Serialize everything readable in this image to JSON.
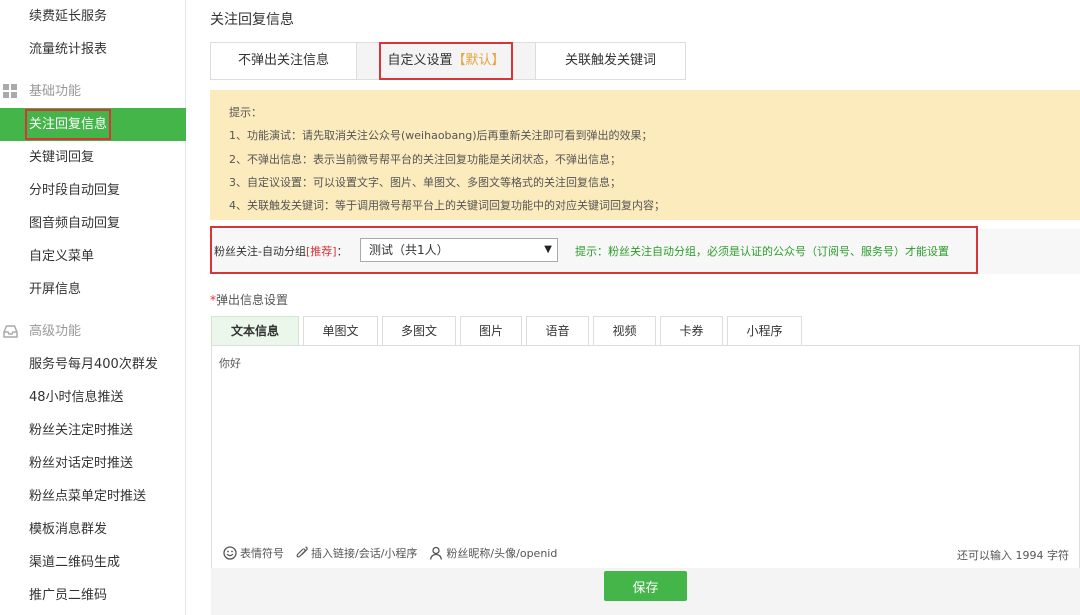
{
  "sidebar": {
    "items_top": [
      {
        "label": "续费延长服务"
      },
      {
        "label": "流量统计报表"
      }
    ],
    "section_basic": {
      "label": "基础功能",
      "icon": "grid-icon"
    },
    "basic_items": [
      {
        "label": "关注回复信息",
        "active": true
      },
      {
        "label": "关键词回复"
      },
      {
        "label": "分时段自动回复"
      },
      {
        "label": "图音频自动回复"
      },
      {
        "label": "自定义菜单"
      },
      {
        "label": "开屏信息"
      }
    ],
    "section_advanced": {
      "label": "高级功能",
      "icon": "inbox-icon"
    },
    "advanced_items": [
      {
        "label": "服务号每月400次群发"
      },
      {
        "label": "48小时信息推送"
      },
      {
        "label": "粉丝关注定时推送"
      },
      {
        "label": "粉丝对话定时推送"
      },
      {
        "label": "粉丝点菜单定时推送"
      },
      {
        "label": "模板消息群发"
      },
      {
        "label": "渠道二维码生成"
      },
      {
        "label": "推广员二维码"
      }
    ]
  },
  "page": {
    "title": "关注回复信息",
    "mode_tabs": [
      {
        "label": "不弹出关注信息"
      },
      {
        "label": "自定义设置",
        "tag": "【默认】",
        "active": true
      },
      {
        "label": "关联触发关键词"
      }
    ],
    "tips": {
      "heading": "提示：",
      "lines": [
        "1、功能演试：请先取消关注公众号(weihaobang)后再重新关注即可看到弹出的效果；",
        "2、不弹出信息：表示当前微号帮平台的关注回复功能是关闭状态，不弹出信息；",
        "3、自定议设置：可以设置文字、图片、单图文、多图文等格式的关注回复信息；",
        "4、关联触发关键词：等于调用微号帮平台上的关键词回复功能中的对应关键词回复内容；"
      ]
    },
    "group": {
      "label_prefix": "粉丝关注-自动分组",
      "label_recommend": "[推荐]",
      "label_suffix": "：",
      "select_value": "测试（共1人）",
      "hint": "提示：粉丝关注自动分组，必须是认证的公众号（订阅号、服务号）才能设置"
    },
    "popup_label_star": "*",
    "popup_label": "弹出信息设置",
    "msg_tabs": [
      {
        "label": "文本信息",
        "active": true
      },
      {
        "label": "单图文"
      },
      {
        "label": "多图文"
      },
      {
        "label": "图片"
      },
      {
        "label": "语音"
      },
      {
        "label": "视频"
      },
      {
        "label": "卡券"
      },
      {
        "label": "小程序"
      }
    ],
    "editor": {
      "text": "你好",
      "tools": [
        {
          "label": "表情符号",
          "icon": "smiley-icon"
        },
        {
          "label": "插入链接/会话/小程序",
          "icon": "link-icon"
        },
        {
          "label": "粉丝昵称/头像/openid",
          "icon": "user-icon"
        }
      ],
      "char_count": "还可以输入 1994 字符"
    },
    "save_label": "保存"
  },
  "colors": {
    "accent_green": "#44b549",
    "highlight_red": "#d9343a",
    "tips_bg": "#fcebbd"
  }
}
